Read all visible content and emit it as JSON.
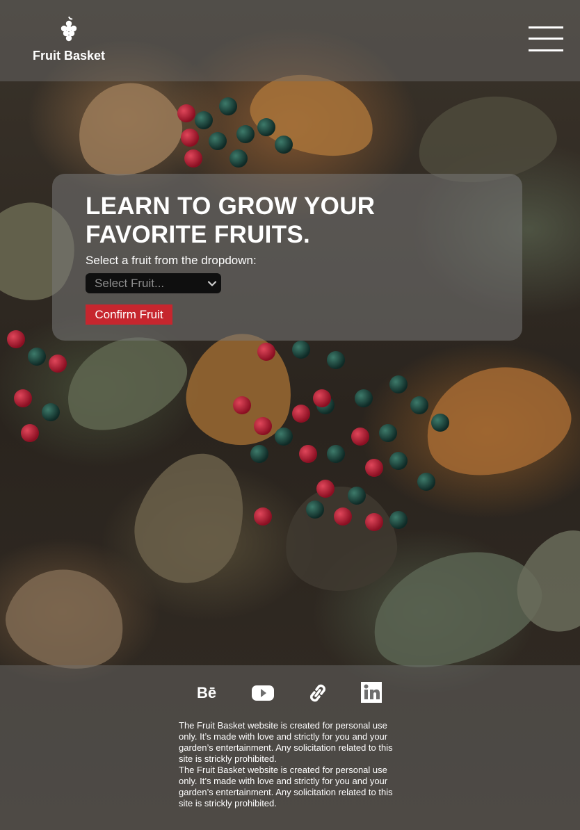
{
  "header": {
    "brand": "Fruit Basket",
    "logo_icon": "grapes-icon",
    "menu_icon": "hamburger-menu-icon"
  },
  "hero": {
    "headline_line1": "LEARN TO GROW YOUR",
    "headline_line2": "FAVORITE FRUITS.",
    "prompt": "Select a fruit from the dropdown:",
    "select_value": "Select Fruit...",
    "confirm_label": "Confirm Fruit"
  },
  "footer": {
    "social_icons": [
      "behance-icon",
      "youtube-icon",
      "link-icon",
      "linkedin-icon"
    ],
    "notice_1": "The Fruit Basket website is created for personal use only. It’s made with love and strictly for you and your garden’s entertainment. Any solicitation related to this site is strickly prohibited.",
    "notice_2": "The Fruit Basket website is created for personal use only. It’s made with love and strictly for you and your garden’s entertainment. Any solicitation related to this site is strickly prohibited."
  },
  "colors": {
    "confirm_button": "#c6262e",
    "select_background": "#0f0f0f",
    "text": "#ffffff"
  }
}
